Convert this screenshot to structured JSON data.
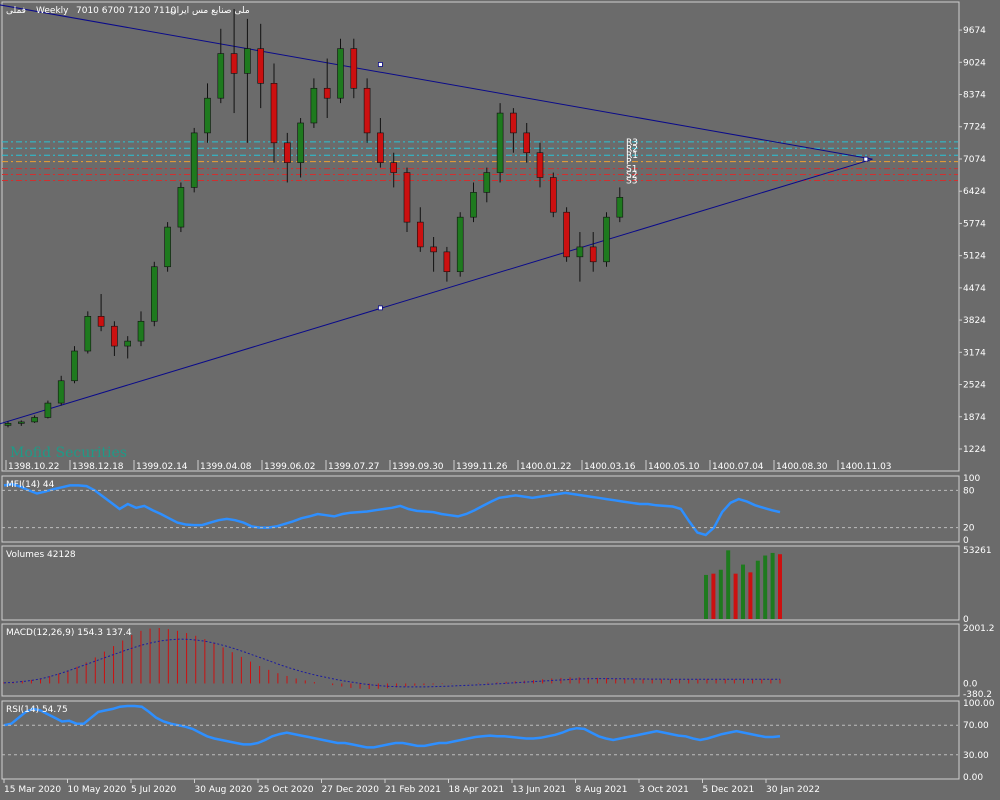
{
  "header": {
    "symbol": "فملی",
    "timeframe": "Weekly",
    "ohlc": "7010 6700 7120 7110",
    "company": "ملی صنایع مس ایران"
  },
  "watermark": "Mofid Securities",
  "colors": {
    "background": "#6b6b6b",
    "bull": "#1e7a1e",
    "bear": "#cc1010",
    "grid": "#bcbcbc",
    "triangle": "#0a0a8a",
    "mfi": "#2e8fff",
    "rsi": "#2e8fff",
    "macd_hist": "#cc1010",
    "macd_signal": "#1a1aa0",
    "resistance": "#26c4d8",
    "support": "#d03030"
  },
  "main_chart": {
    "type": "candlestick",
    "y_range": [
      800,
      10200
    ],
    "price_ticks": [
      "9674",
      "9024",
      "8374",
      "7724",
      "7074",
      "6424",
      "5774",
      "5124",
      "4474",
      "3824",
      "3174",
      "2524",
      "1874",
      "1224"
    ],
    "date_labels_top": [
      "1398.10.22",
      "1398.12.18",
      "1399.02.14",
      "1399.04.08",
      "1399.06.02",
      "1399.07.27",
      "1399.09.30",
      "1399.11.26",
      "1400.01.22",
      "1400.03.16",
      "1400.05.10",
      "1400.07.04",
      "1400.08.30",
      "1400.11.03"
    ],
    "pivot_labels": [
      "R3",
      "R2",
      "R1",
      "P",
      "S1",
      "S2",
      "S3"
    ],
    "pivot_levels": [
      7420,
      7290,
      7150,
      7020,
      6880,
      6760,
      6640
    ],
    "triangle": {
      "upper_line": [
        [
          -1,
          10200
        ],
        [
          65,
          7070
        ]
      ],
      "lower_line": [
        [
          -1,
          1700
        ],
        [
          65,
          7070
        ]
      ],
      "upper_marker": [
        28,
        8980
      ],
      "lower_marker": [
        28,
        4070
      ],
      "apex": [
        64.5,
        7070
      ]
    }
  },
  "chart_data": {
    "type": "candlestick",
    "title": "فملی, Weekly",
    "ylim": [
      800,
      10200
    ],
    "candles": [
      {
        "o": 1700,
        "h": 1780,
        "l": 1660,
        "c": 1740
      },
      {
        "o": 1740,
        "h": 1800,
        "l": 1690,
        "c": 1770
      },
      {
        "o": 1770,
        "h": 1900,
        "l": 1750,
        "c": 1860
      },
      {
        "o": 1860,
        "h": 2200,
        "l": 1840,
        "c": 2150
      },
      {
        "o": 2150,
        "h": 2700,
        "l": 2100,
        "c": 2600
      },
      {
        "o": 2600,
        "h": 3300,
        "l": 2550,
        "c": 3200
      },
      {
        "o": 3200,
        "h": 4000,
        "l": 3150,
        "c": 3900
      },
      {
        "o": 3900,
        "h": 4350,
        "l": 3600,
        "c": 3700
      },
      {
        "o": 3700,
        "h": 3800,
        "l": 3100,
        "c": 3300
      },
      {
        "o": 3300,
        "h": 3500,
        "l": 3050,
        "c": 3400
      },
      {
        "o": 3400,
        "h": 4000,
        "l": 3300,
        "c": 3800
      },
      {
        "o": 3800,
        "h": 5000,
        "l": 3700,
        "c": 4900
      },
      {
        "o": 4900,
        "h": 5800,
        "l": 4800,
        "c": 5700
      },
      {
        "o": 5700,
        "h": 6600,
        "l": 5600,
        "c": 6500
      },
      {
        "o": 6500,
        "h": 7700,
        "l": 6400,
        "c": 7600
      },
      {
        "o": 7600,
        "h": 8600,
        "l": 7400,
        "c": 8300
      },
      {
        "o": 8300,
        "h": 9700,
        "l": 8200,
        "c": 9200
      },
      {
        "o": 9200,
        "h": 10100,
        "l": 8000,
        "c": 8800
      },
      {
        "o": 8800,
        "h": 9900,
        "l": 7400,
        "c": 9300
      },
      {
        "o": 9300,
        "h": 9800,
        "l": 8100,
        "c": 8600
      },
      {
        "o": 8600,
        "h": 9000,
        "l": 7000,
        "c": 7400
      },
      {
        "o": 7400,
        "h": 7600,
        "l": 6600,
        "c": 7000
      },
      {
        "o": 7000,
        "h": 7900,
        "l": 6700,
        "c": 7800
      },
      {
        "o": 7800,
        "h": 8700,
        "l": 7700,
        "c": 8500
      },
      {
        "o": 8500,
        "h": 9100,
        "l": 7900,
        "c": 8300
      },
      {
        "o": 8300,
        "h": 9500,
        "l": 8200,
        "c": 9300
      },
      {
        "o": 9300,
        "h": 9500,
        "l": 8300,
        "c": 8500
      },
      {
        "o": 8500,
        "h": 8700,
        "l": 7400,
        "c": 7600
      },
      {
        "o": 7600,
        "h": 7900,
        "l": 6900,
        "c": 7000
      },
      {
        "o": 7000,
        "h": 7200,
        "l": 6500,
        "c": 6800
      },
      {
        "o": 6800,
        "h": 6900,
        "l": 5600,
        "c": 5800
      },
      {
        "o": 5800,
        "h": 6100,
        "l": 5200,
        "c": 5300
      },
      {
        "o": 5300,
        "h": 5500,
        "l": 4800,
        "c": 5200
      },
      {
        "o": 5200,
        "h": 5300,
        "l": 4600,
        "c": 4800
      },
      {
        "o": 4800,
        "h": 6000,
        "l": 4700,
        "c": 5900
      },
      {
        "o": 5900,
        "h": 6600,
        "l": 5800,
        "c": 6400
      },
      {
        "o": 6400,
        "h": 6900,
        "l": 6200,
        "c": 6800
      },
      {
        "o": 6800,
        "h": 8200,
        "l": 6600,
        "c": 8000
      },
      {
        "o": 8000,
        "h": 8100,
        "l": 7200,
        "c": 7600
      },
      {
        "o": 7600,
        "h": 7800,
        "l": 7000,
        "c": 7200
      },
      {
        "o": 7200,
        "h": 7400,
        "l": 6500,
        "c": 6700
      },
      {
        "o": 6700,
        "h": 6800,
        "l": 5900,
        "c": 6000
      },
      {
        "o": 6000,
        "h": 6100,
        "l": 5000,
        "c": 5100
      },
      {
        "o": 5100,
        "h": 5600,
        "l": 4600,
        "c": 5300
      },
      {
        "o": 5300,
        "h": 5600,
        "l": 4800,
        "c": 5000
      },
      {
        "o": 5000,
        "h": 6000,
        "l": 4900,
        "c": 5900
      },
      {
        "o": 5900,
        "h": 6500,
        "l": 5800,
        "c": 6300
      }
    ],
    "indicators": {
      "mfi": {
        "label": "MFI(14) 44",
        "ylim": [
          0,
          100
        ],
        "ticks": [
          "100",
          "80",
          "20",
          "0"
        ],
        "levels": [
          80,
          20
        ],
        "values": [
          88,
          90,
          86,
          80,
          75,
          78,
          82,
          85,
          88,
          88,
          87,
          80,
          70,
          60,
          50,
          58,
          52,
          55,
          48,
          42,
          35,
          28,
          25,
          24,
          24,
          28,
          32,
          34,
          32,
          28,
          22,
          20,
          20,
          22,
          26,
          30,
          35,
          38,
          42,
          40,
          38,
          42,
          44,
          45,
          46,
          48,
          50,
          52,
          55,
          50,
          47,
          46,
          45,
          42,
          40,
          38,
          42,
          48,
          55,
          62,
          68,
          70,
          72,
          70,
          68,
          70,
          72,
          74,
          76,
          74,
          72,
          70,
          68,
          66,
          64,
          62,
          60,
          58,
          58,
          56,
          55,
          54,
          50,
          30,
          12,
          8,
          20,
          45,
          60,
          66,
          62,
          56,
          52,
          48,
          45
        ]
      },
      "volumes": {
        "label": "Volumes 42128",
        "ylim": [
          0,
          53261
        ],
        "ticks": [
          "53261",
          "0"
        ],
        "bars": [
          {
            "v": 34000,
            "up": true
          },
          {
            "v": 35000,
            "up": false
          },
          {
            "v": 38000,
            "up": true
          },
          {
            "v": 53000,
            "up": true
          },
          {
            "v": 35000,
            "up": false
          },
          {
            "v": 42000,
            "up": true
          },
          {
            "v": 36000,
            "up": false
          },
          {
            "v": 45000,
            "up": true
          },
          {
            "v": 49000,
            "up": true
          },
          {
            "v": 51000,
            "up": true
          },
          {
            "v": 50000,
            "up": false
          }
        ]
      },
      "macd": {
        "label": "MACD(12,26,9) 154.3 137.4",
        "ylim": [
          -380.2,
          2001.2
        ],
        "ticks": [
          "2001.2",
          "0.0",
          "-380.2"
        ],
        "hist": [
          40,
          60,
          90,
          130,
          180,
          260,
          360,
          470,
          600,
          760,
          940,
          1150,
          1350,
          1550,
          1750,
          1900,
          1980,
          2000,
          1960,
          1900,
          1820,
          1720,
          1600,
          1460,
          1300,
          1130,
          960,
          790,
          630,
          490,
          370,
          270,
          180,
          110,
          50,
          0,
          -60,
          -110,
          -160,
          -190,
          -200,
          -190,
          -170,
          -140,
          -110,
          -80,
          -60,
          -40,
          -20,
          -10,
          0,
          10,
          20,
          30,
          40,
          60,
          80,
          100,
          120,
          150,
          180,
          200,
          220,
          220,
          210,
          200,
          190,
          180,
          170,
          160,
          150,
          150,
          150,
          150,
          150,
          150,
          150,
          150,
          150,
          150,
          150,
          150,
          150,
          150,
          150,
          150
        ],
        "signal": [
          20,
          40,
          70,
          110,
          170,
          250,
          350,
          460,
          580,
          700,
          820,
          940,
          1060,
          1180,
          1290,
          1390,
          1470,
          1540,
          1580,
          1600,
          1590,
          1560,
          1510,
          1440,
          1350,
          1250,
          1140,
          1020,
          900,
          780,
          660,
          550,
          450,
          360,
          280,
          210,
          140,
          80,
          30,
          -20,
          -60,
          -90,
          -110,
          -120,
          -125,
          -125,
          -120,
          -110,
          -100,
          -85,
          -70,
          -55,
          -40,
          -20,
          0,
          20,
          40,
          60,
          80,
          100,
          120,
          140,
          160,
          170,
          175,
          175,
          172,
          168,
          164,
          160,
          158,
          156,
          155,
          154,
          154,
          154,
          154,
          154,
          154,
          154,
          154,
          154,
          154,
          154,
          154
        ]
      },
      "rsi": {
        "label": "RSI(14) 54.75",
        "ylim": [
          0,
          100
        ],
        "ticks": [
          "100.00",
          "70.00",
          "30.00",
          "0.00"
        ],
        "levels": [
          70,
          30
        ],
        "values": [
          70,
          72,
          80,
          88,
          92,
          90,
          85,
          80,
          75,
          76,
          72,
          72,
          80,
          88,
          90,
          92,
          95,
          96,
          96,
          95,
          88,
          80,
          75,
          72,
          70,
          68,
          65,
          60,
          55,
          52,
          50,
          48,
          46,
          44,
          44,
          46,
          50,
          55,
          58,
          60,
          58,
          56,
          54,
          52,
          50,
          48,
          46,
          46,
          44,
          42,
          40,
          40,
          42,
          44,
          46,
          46,
          44,
          42,
          42,
          44,
          46,
          46,
          48,
          50,
          52,
          54,
          55,
          56,
          55,
          55,
          54,
          53,
          52,
          52,
          53,
          55,
          57,
          60,
          64,
          66,
          65,
          60,
          55,
          52,
          50,
          52,
          54,
          56,
          58,
          60,
          62,
          60,
          58,
          56,
          55,
          52,
          50,
          52,
          55,
          58,
          60,
          62,
          60,
          58,
          56,
          54,
          54,
          55
        ]
      }
    },
    "x_labels_bottom": [
      "15 Mar 2020",
      "10 May 2020",
      "5 Jul 2020",
      "30 Aug 2020",
      "25 Oct 2020",
      "27 Dec 2020",
      "21 Feb 2021",
      "18 Apr 2021",
      "13 Jun 2021",
      "8 Aug 2021",
      "3 Oct 2021",
      "5 Dec 2021",
      "30 Jan 2022"
    ]
  }
}
